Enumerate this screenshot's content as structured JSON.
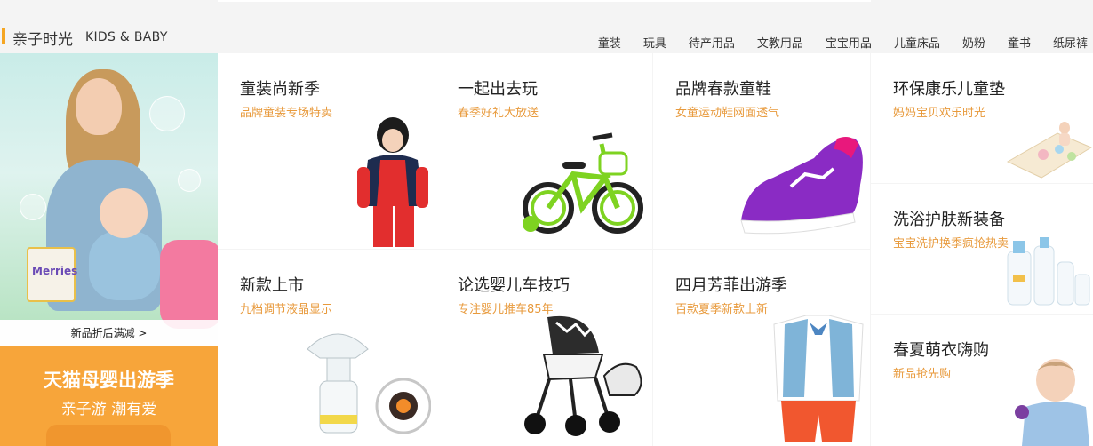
{
  "header": {
    "title": "亲子时光",
    "subtitle": "KIDS & BABY",
    "accent_color": "#f5a623",
    "nav": [
      "童装",
      "玩具",
      "待产用品",
      "文教用品",
      "宝宝用品",
      "儿童床品",
      "奶粉",
      "童书",
      "纸尿裤"
    ]
  },
  "banner": {
    "product_logo": "Merries",
    "caption": "新品折后满减 >",
    "headline": "天猫母婴出游季",
    "slogan": "亲子游 潮有爱",
    "bg_color": "#f7a53a"
  },
  "cards": [
    {
      "title": "童装尚新季",
      "subtitle": "品牌童装专场特卖",
      "image": "girl-outfit-image"
    },
    {
      "title": "一起出去玩",
      "subtitle": "春季好礼大放送",
      "image": "kids-bike-image"
    },
    {
      "title": "品牌春款童鞋",
      "subtitle": "女童运动鞋网面透气",
      "image": "purple-sneaker-image"
    },
    {
      "title": "环保康乐儿童垫",
      "subtitle": "妈妈宝贝欢乐时光",
      "image": "play-mat-image"
    },
    {
      "title": "新款上市",
      "subtitle": "九档调节液晶显示",
      "image": "breast-pump-image"
    },
    {
      "title": "论选婴儿车技巧",
      "subtitle": "专注婴儿推车85年",
      "image": "stroller-image"
    },
    {
      "title": "四月芳菲出游季",
      "subtitle": "百款夏季新款上新",
      "image": "boy-outfit-image"
    },
    {
      "title": "洗浴护肤新装备",
      "subtitle": "宝宝洗护换季疯抢热卖",
      "image": "bath-products-image"
    },
    {
      "title": "春夏萌衣嗨购",
      "subtitle": "新品抢先购",
      "image": "toddler-boy-image"
    }
  ]
}
